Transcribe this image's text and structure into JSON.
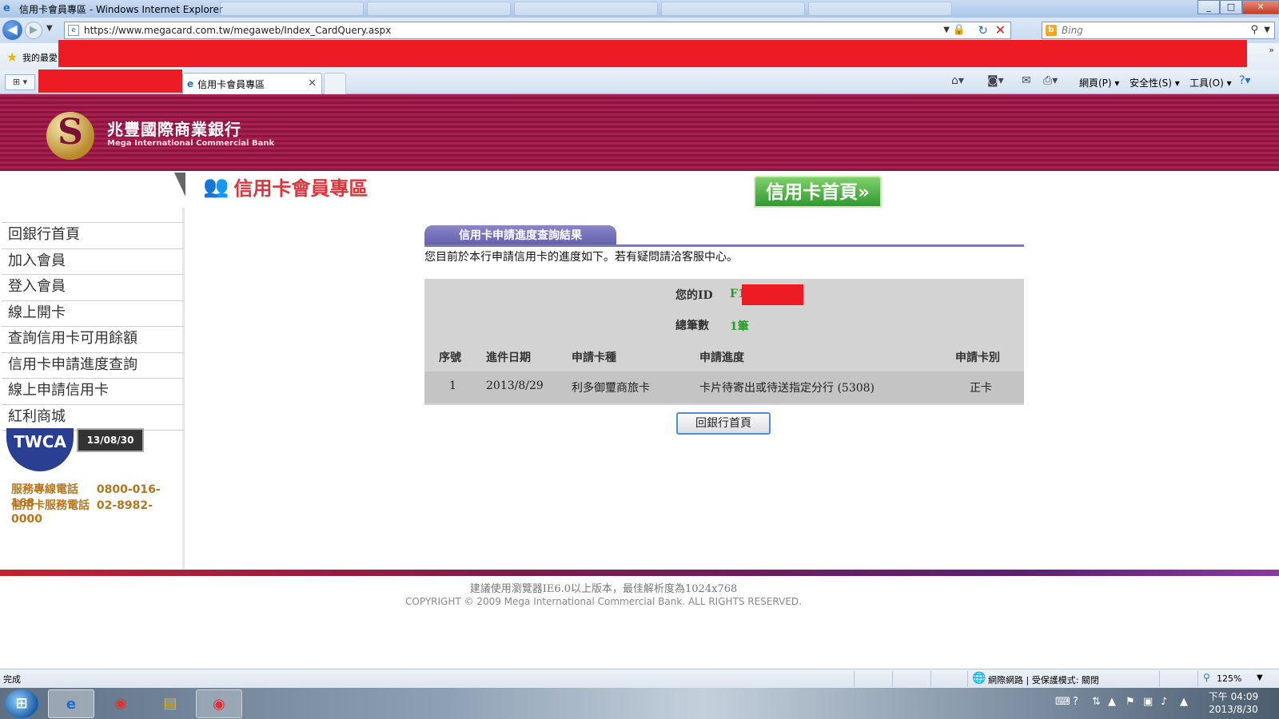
{
  "window": {
    "title": "信用卡會員專區 - Windows Internet Explorer",
    "minimize": "_",
    "maximize": "□",
    "close": "✕"
  },
  "browser": {
    "url": "https://www.megacard.com.tw/megaweb/Index_CardQuery.aspx",
    "search_placeholder": "Bing",
    "favorites_label": "我的最愛",
    "active_tab_title": "信用卡會員專區",
    "commands": {
      "page": "網頁(P) ▾",
      "safety": "安全性(S) ▾",
      "tools": "工具(O) ▾"
    },
    "status_left": "完成",
    "status_zone": "網際網路 | 受保護模式: 關閉",
    "zoom": "125%"
  },
  "bank": {
    "name_zh": "兆豐國際商業銀行",
    "name_en": "Mega International Commercial Bank"
  },
  "header": {
    "member_area_title": "信用卡會員專區",
    "card_home_button": "信用卡首頁»"
  },
  "sidebar": {
    "items": [
      {
        "label": "回銀行首頁"
      },
      {
        "label": "加入會員"
      },
      {
        "label": "登入會員"
      },
      {
        "label": "線上開卡"
      },
      {
        "label": "查詢信用卡可用餘額"
      },
      {
        "label": "信用卡申請進度查詢"
      },
      {
        "label": "線上申請信用卡"
      },
      {
        "label": "紅利商城"
      }
    ],
    "twca_seal": "TWCA",
    "twca_date": "13/08/30",
    "phones": [
      {
        "label": "服務專線電話",
        "number": "0800-016-168"
      },
      {
        "label": "信用卡服務電話",
        "number": "02-8982-0000"
      }
    ]
  },
  "result": {
    "section_title": "信用卡申請進度查詢結果",
    "intro": "您目前於本行申請信用卡的進度如下。若有疑問請洽客服中心。",
    "id_label": "您的ID",
    "id_value": "F1",
    "count_label": "總筆數",
    "count_value": "1筆",
    "columns": [
      "序號",
      "進件日期",
      "申請卡種",
      "申請進度",
      "申請卡別"
    ],
    "rows": [
      {
        "seq": "1",
        "date": "2013/8/29",
        "card_type": "利多御璽商旅卡",
        "progress": "卡片待寄出或待送指定分行 (5308)",
        "card_class": "正卡"
      }
    ],
    "back_button": "回銀行首頁"
  },
  "footer": {
    "browser_notice": "建議使用瀏覽器IE6.0以上版本，最佳解析度為1024x768",
    "copyright": "COPYRIGHT © 2009 Mega International Commercial Bank. ALL RIGHTS RESERVED."
  },
  "taskbar": {
    "clock_time": "下午 04:09",
    "clock_date": "2013/8/30"
  },
  "colors": {
    "banner": "#a8204f",
    "accent_green": "#2a9a2a",
    "tab_purple": "#7c78b8",
    "redaction": "#ed1c24"
  }
}
